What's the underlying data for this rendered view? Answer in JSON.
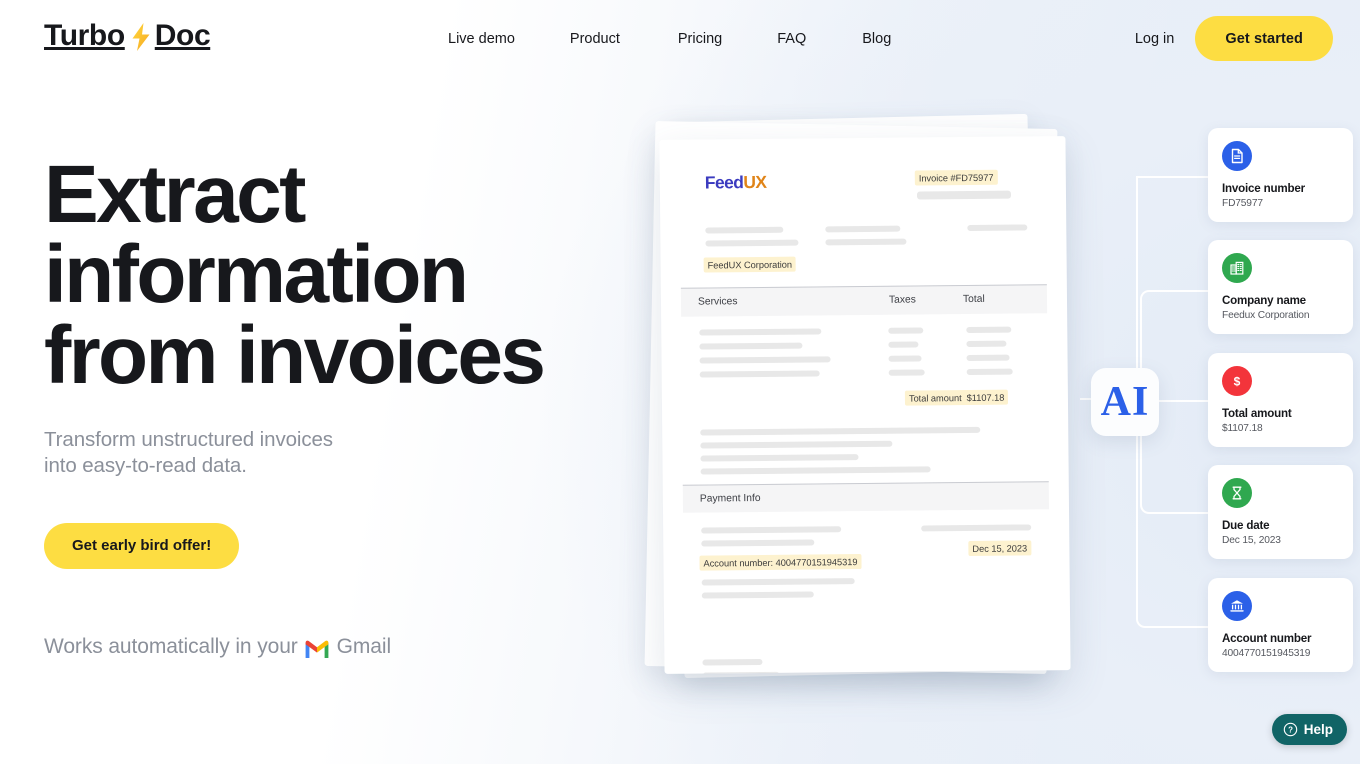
{
  "brand": {
    "name_part1": "Turbo",
    "name_part2": "Doc",
    "bolt_icon": "lightning-bolt-icon",
    "accent_yellow": "#fddd42",
    "text_dark": "#17181c"
  },
  "nav": {
    "items": [
      {
        "label": "Live demo",
        "name": "nav-live-demo"
      },
      {
        "label": "Product",
        "name": "nav-product"
      },
      {
        "label": "Pricing",
        "name": "nav-pricing"
      },
      {
        "label": "FAQ",
        "name": "nav-faq"
      },
      {
        "label": "Blog",
        "name": "nav-blog"
      }
    ],
    "login_label": "Log in",
    "get_started_label": "Get started"
  },
  "hero": {
    "heading_line1": "Extract",
    "heading_line2": "information",
    "heading_line3": "from invoices",
    "subheading_line1": "Transform unstructured invoices",
    "subheading_line2": "into easy-to-read data.",
    "cta_label": "Get early bird offer!",
    "works_prefix": "Works automatically in your",
    "works_suffix": "Gmail",
    "gmail_icon": "gmail-icon"
  },
  "invoice": {
    "company_logo_part1": "Feed",
    "company_logo_part2": "UX",
    "invoice_number_label": "Invoice #FD75977",
    "company_name_highlight": "FeedUX Corporation",
    "table_headers": [
      "Services",
      "Taxes",
      "Total"
    ],
    "total_amount_label": "Total amount",
    "total_amount_value": "$1107.18",
    "payment_info_label": "Payment Info",
    "account_number_highlight": "Account number: 4004770151945319",
    "due_date_highlight": "Dec 15, 2023"
  },
  "ai_chip": {
    "label": "AI",
    "color": "#2b60e8"
  },
  "extracted_cards": [
    {
      "title": "Invoice number",
      "value": "FD75977",
      "icon": "document-icon",
      "icon_bg": "#2b60e8",
      "name": "card-invoice-number"
    },
    {
      "title": "Company name",
      "value": "Feedux Corporation",
      "icon": "building-icon",
      "icon_bg": "#2fa84f",
      "name": "card-company-name"
    },
    {
      "title": "Total amount",
      "value": "$1107.18",
      "icon": "dollar-icon",
      "icon_bg": "#f3343b",
      "name": "card-total-amount"
    },
    {
      "title": "Due date",
      "value": "Dec 15, 2023",
      "icon": "hourglass-icon",
      "icon_bg": "#2fa84f",
      "name": "card-due-date"
    },
    {
      "title": "Account number",
      "value": "4004770151945319",
      "icon": "bank-icon",
      "icon_bg": "#2b60e8",
      "name": "card-account-number"
    }
  ],
  "help_widget": {
    "label": "Help",
    "icon": "question-circle-icon",
    "bg": "#116466"
  }
}
